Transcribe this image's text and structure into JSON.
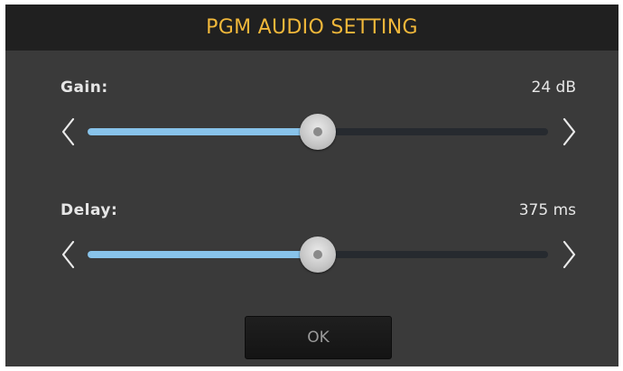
{
  "dialog": {
    "title": "PGM AUDIO SETTING",
    "ok_label": "OK"
  },
  "gain": {
    "label": "Gain:",
    "value_text": "24 dB",
    "slider_fraction": 0.5
  },
  "delay": {
    "label": "Delay:",
    "value_text": "375 ms",
    "slider_fraction": 0.5
  },
  "colors": {
    "title_text": "#f0b73a",
    "slider_fill": "#88c3ea",
    "slider_track": "#262a2f",
    "background": "#3a3a3a"
  },
  "icons": {
    "decrease": "chevron-left-icon",
    "increase": "chevron-right-icon"
  }
}
